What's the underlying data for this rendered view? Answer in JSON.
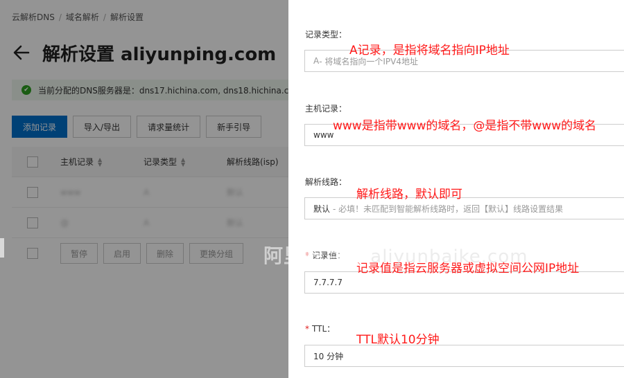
{
  "breadcrumb": {
    "items": [
      "云解析DNS",
      "域名解析",
      "解析设置"
    ]
  },
  "page": {
    "title": "解析设置 aliyunping.com"
  },
  "notice": {
    "text": "当前分配的DNS服务器是：dns17.hichina.com, dns18.hichina.c"
  },
  "toolbar": {
    "buttons": [
      "添加记录",
      "导入/导出",
      "请求量统计",
      "新手引导"
    ]
  },
  "table": {
    "headers": [
      "主机记录",
      "记录类型",
      "解析线路(isp)"
    ],
    "rows": [
      [
        "www",
        "A",
        "默认"
      ],
      [
        "@",
        "A",
        "默认"
      ]
    ]
  },
  "batch": {
    "buttons": [
      "暂停",
      "启用",
      "删除",
      "更换分组"
    ]
  },
  "form": {
    "record_type": {
      "label": "记录类型：",
      "value": "A",
      "hint": "- 将域名指向一个IPV4地址",
      "annotation": "A记录，是指将域名指向IP地址"
    },
    "host": {
      "label": "主机记录：",
      "value": "www",
      "annotation": "www是指带www的域名，@是指不带www的域名"
    },
    "line": {
      "label": "解析线路：",
      "value": "默认",
      "hint": "- 必填！未匹配到智能解析线路时，返回【默认】线路设置结果",
      "annotation": "解析线路，默认即可"
    },
    "value": {
      "required": "*",
      "label": "记录值：",
      "value": "7.7.7.7",
      "annotation": "记录值是指云服务器或虚拟空间公网IP地址"
    },
    "ttl": {
      "required": "*",
      "label": "TTL：",
      "value": "10 分钟",
      "annotation": "TTL默认10分钟"
    }
  },
  "watermark": {
    "cn": "阿里云百科",
    "domain": " aliyunbaike.com"
  },
  "colors": {
    "primary": "#0070cc",
    "annotation": "#ff1a1a",
    "success": "#2ea121",
    "required": "#e02020"
  }
}
